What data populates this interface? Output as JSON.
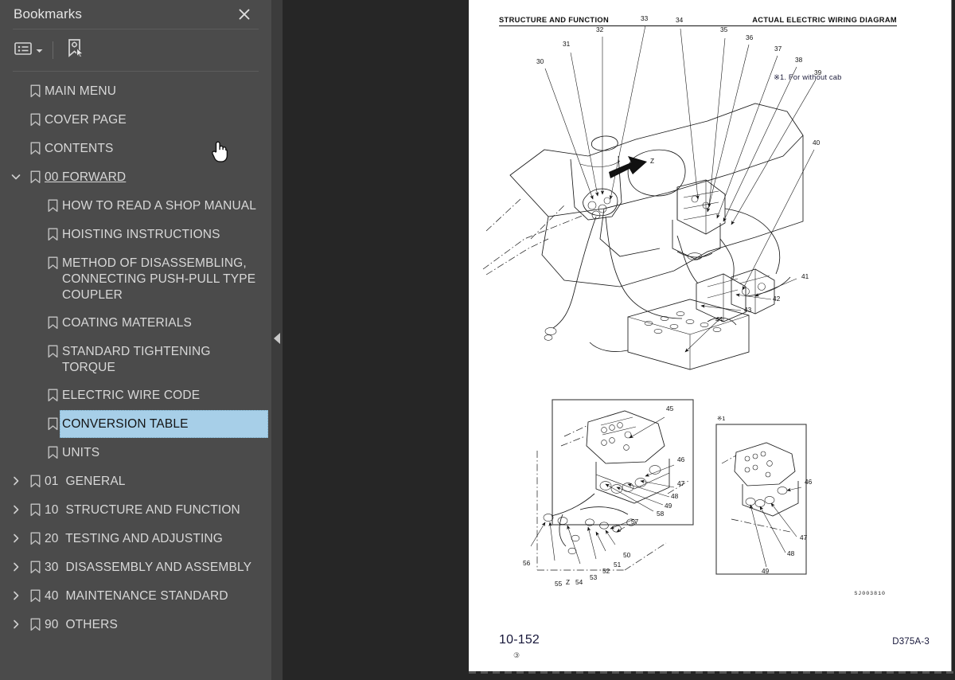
{
  "panel": {
    "title": "Bookmarks",
    "close_icon": "close-icon",
    "toolbar": {
      "options_label": "list-options-icon",
      "options_caret": "chevron-down-icon",
      "new_bookmark_label": "new-bookmark-icon"
    }
  },
  "bookmarks": [
    {
      "label": "MAIN MENU",
      "level": 0,
      "twisty": "none",
      "state": "normal"
    },
    {
      "label": "COVER PAGE",
      "level": 0,
      "twisty": "none",
      "state": "normal"
    },
    {
      "label": "CONTENTS",
      "level": 0,
      "twisty": "none",
      "state": "normal"
    },
    {
      "label": "00 FORWARD",
      "level": 0,
      "twisty": "expanded",
      "state": "current"
    },
    {
      "label": "HOW TO READ A SHOP MANUAL",
      "level": 1,
      "twisty": "none",
      "state": "normal"
    },
    {
      "label": "HOISTING INSTRUCTIONS",
      "level": 1,
      "twisty": "none",
      "state": "normal"
    },
    {
      "label": "METHOD OF DISASSEMBLING, CONNECTING PUSH-PULL TYPE COUPLER",
      "level": 1,
      "twisty": "none",
      "state": "normal"
    },
    {
      "label": "COATING MATERIALS",
      "level": 1,
      "twisty": "none",
      "state": "normal"
    },
    {
      "label": "STANDARD TIGHTENING TORQUE",
      "level": 1,
      "twisty": "none",
      "state": "normal"
    },
    {
      "label": "ELECTRIC WIRE CODE",
      "level": 1,
      "twisty": "none",
      "state": "normal"
    },
    {
      "label": "CONVERSION TABLE",
      "level": 1,
      "twisty": "none",
      "state": "selected"
    },
    {
      "label": "UNITS",
      "level": 1,
      "twisty": "none",
      "state": "normal"
    },
    {
      "label": "01  GENERAL",
      "level": 0,
      "twisty": "collapsed",
      "state": "normal"
    },
    {
      "label": "10  STRUCTURE AND FUNCTION",
      "level": 0,
      "twisty": "collapsed",
      "state": "normal"
    },
    {
      "label": "20  TESTING AND ADJUSTING",
      "level": 0,
      "twisty": "collapsed",
      "state": "normal"
    },
    {
      "label": "30  DISASSEMBLY AND ASSEMBLY",
      "level": 0,
      "twisty": "collapsed",
      "state": "normal"
    },
    {
      "label": "40  MAINTENANCE STANDARD",
      "level": 0,
      "twisty": "collapsed",
      "state": "normal"
    },
    {
      "label": "90  OTHERS",
      "level": 0,
      "twisty": "collapsed",
      "state": "normal"
    }
  ],
  "document": {
    "header_left": "STRUCTURE AND FUNCTION",
    "header_right": "ACTUAL ELECTRIC WIRING DIAGRAM",
    "note": "※1.  For without cab",
    "inset_note": "※1",
    "drawing_number": "SJ003810",
    "page_number": "10-152",
    "revision": "③",
    "model_code": "D375A-3",
    "callouts_main": [
      "30",
      "31",
      "32",
      "33",
      "34",
      "35",
      "36",
      "37",
      "38",
      "39",
      "40",
      "41",
      "42",
      "43",
      "44"
    ],
    "callouts_detail": [
      "45",
      "46",
      "47",
      "48",
      "49",
      "50",
      "51",
      "52",
      "53",
      "54",
      "55",
      "56",
      "57",
      "58",
      "Z"
    ],
    "callouts_inset": [
      "46",
      "47",
      "48",
      "49"
    ],
    "direction_marks": [
      "Z"
    ]
  },
  "colors": {
    "panel_bg": "#4b4b4b",
    "viewer_bg": "#262626",
    "selection": "#a7cfe8",
    "text": "#d8d8d8"
  }
}
